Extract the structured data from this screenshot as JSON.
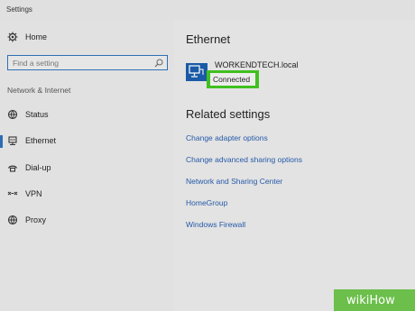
{
  "window": {
    "title": "Settings"
  },
  "sidebar": {
    "home_label": "Home",
    "search_placeholder": "Find a setting",
    "section_label": "Network & Internet",
    "items": [
      {
        "label": "Status",
        "icon": "globe-icon"
      },
      {
        "label": "Ethernet",
        "icon": "ethernet-icon",
        "active": true
      },
      {
        "label": "Dial-up",
        "icon": "dialup-icon"
      },
      {
        "label": "VPN",
        "icon": "vpn-icon"
      },
      {
        "label": "Proxy",
        "icon": "proxy-globe-icon"
      }
    ]
  },
  "main": {
    "heading": "Ethernet",
    "network_name": "WORKENDTECH.local",
    "network_status": "Connected",
    "related_heading": "Related settings",
    "links": [
      "Change adapter options",
      "Change advanced sharing options",
      "Network and Sharing Center",
      "HomeGroup",
      "Windows Firewall"
    ]
  },
  "watermark": {
    "text": "wikiHow"
  },
  "colors": {
    "accent": "#2d6db3",
    "link": "#2559a8",
    "highlight": "#40c020",
    "network_icon": "#1a5aa6"
  }
}
